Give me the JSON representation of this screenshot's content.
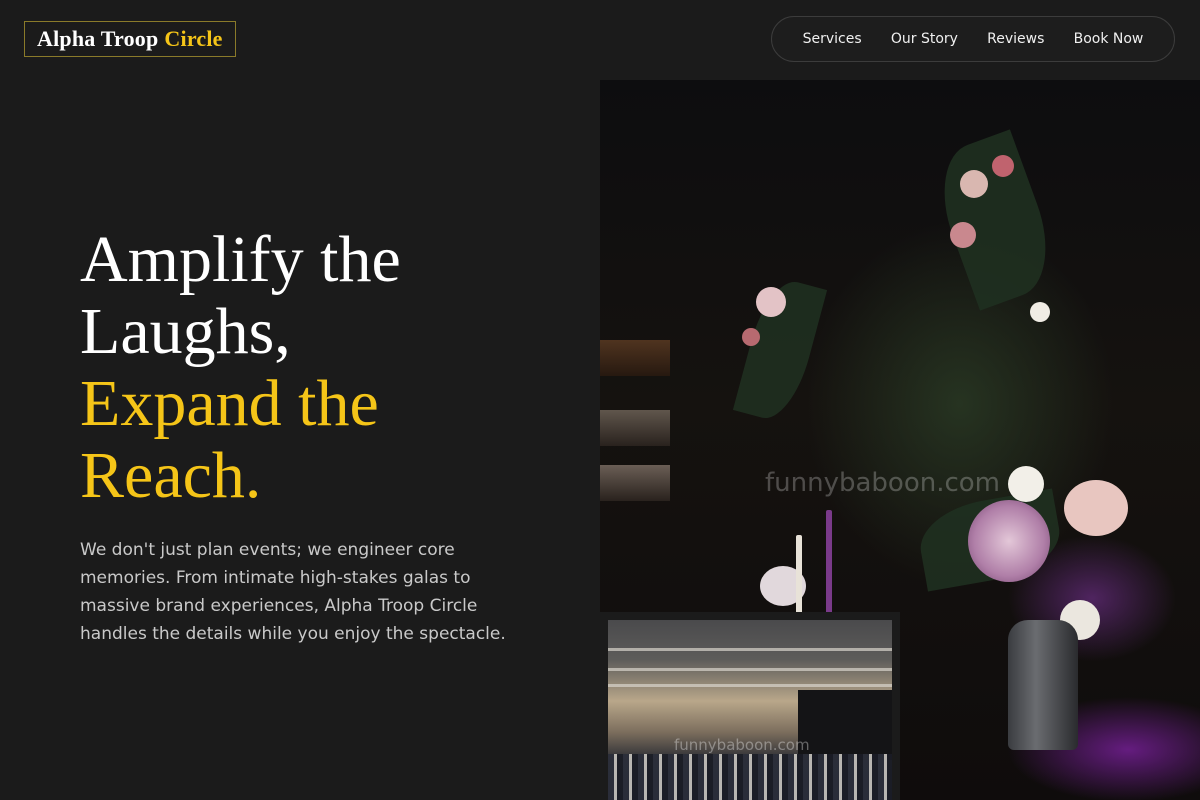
{
  "header": {
    "logo": {
      "main": "Alpha Troop",
      "accent": "Circle"
    },
    "nav": [
      {
        "label": "Services"
      },
      {
        "label": "Our Story"
      },
      {
        "label": "Reviews"
      },
      {
        "label": "Book Now"
      }
    ]
  },
  "hero": {
    "headline": {
      "line1": "Amplify the",
      "line2": "Laughs,",
      "line3": "Expand the",
      "line4": "Reach."
    },
    "description": "We don't just plan events; we engineer core memories. From intimate high-stakes galas to massive brand experiences, Alpha Troop Circle handles the details while you enjoy the spectacle."
  },
  "images": {
    "main_watermark": "funnybaboon.com",
    "inset_watermark": "funnybaboon.com"
  },
  "colors": {
    "background": "#1b1b1b",
    "accent": "#f5c518",
    "text": "#ffffff",
    "muted_text": "#c9c9c9"
  }
}
